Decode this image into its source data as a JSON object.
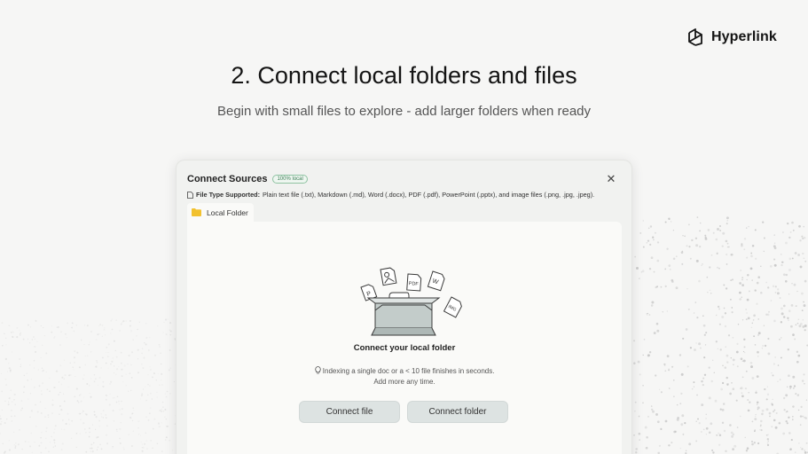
{
  "brand": {
    "name": "Hyperlink",
    "logo_icon": "hyperlink-logo-icon"
  },
  "hero": {
    "title": "2. Connect local folders and files",
    "subtitle": "Begin with small files to explore - add larger folders when ready"
  },
  "dialog": {
    "title": "Connect Sources",
    "badge": "100% local",
    "close_icon": "close-icon",
    "supported_label": "File Type Supported:",
    "supported_text": "Plain text file (.txt), Markdown (.md), Word (.docx), PDF (.pdf), PowerPoint (.pptx), and image files (.png, .jpg, .jpeg).",
    "tab_label": "Local Folder",
    "panel": {
      "heading": "Connect your local folder",
      "hint_line1": "Indexing a single doc or a < 10 file finishes in seconds.",
      "hint_line2": "Add more any time.",
      "connect_file": "Connect file",
      "connect_folder": "Connect folder",
      "illustration_labels": [
        "PDF",
        "W",
        "P",
        "IMG"
      ]
    }
  },
  "colors": {
    "background": "#f6f6f5",
    "dialog": "#f1f2f0",
    "panel": "#fafaf8",
    "button": "#dde3e2",
    "badge_green": "#3d7f56",
    "folder_yellow": "#f2c12e"
  }
}
